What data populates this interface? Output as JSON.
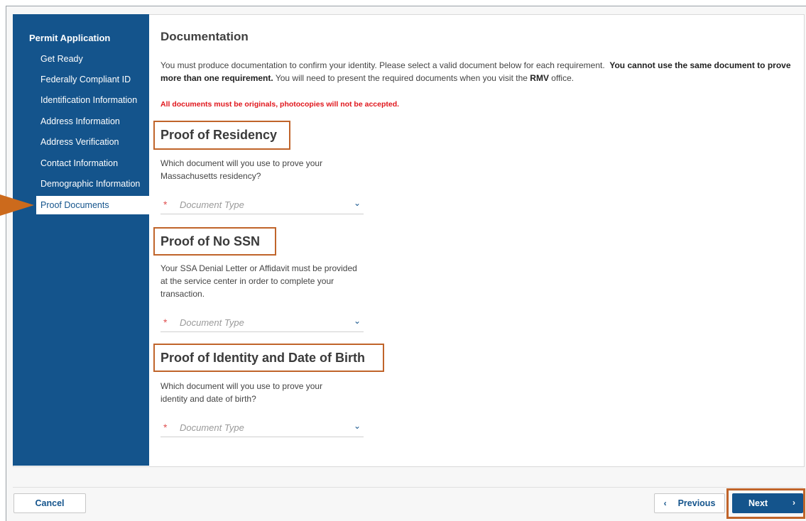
{
  "sidebar": {
    "title": "Permit Application",
    "items": [
      {
        "label": "Get Ready"
      },
      {
        "label": "Federally Compliant ID"
      },
      {
        "label": "Identification Information"
      },
      {
        "label": "Address Information"
      },
      {
        "label": "Address Verification"
      },
      {
        "label": "Contact Information"
      },
      {
        "label": "Demographic Information"
      },
      {
        "label": "Proof Documents",
        "active": true
      }
    ]
  },
  "main": {
    "title": "Documentation",
    "intro_normal_1": "You must produce documentation to confirm your identity. Please select a valid document below for each requirement.",
    "intro_bold": "You cannot use the same document to prove more than one requirement.",
    "intro_normal_2": "You will need to present the required documents when you visit the",
    "intro_rmv": "RMV",
    "intro_end": "office.",
    "warning": "All documents must be originals, photocopies will not be accepted.",
    "sections": [
      {
        "heading": "Proof of Residency",
        "description": "Which document will you use to prove your Massachusetts residency?",
        "select_required_mark": "*",
        "select_placeholder": "Document Type"
      },
      {
        "heading": "Proof of No SSN",
        "description": "Your SSA Denial Letter or Affidavit must be provided at the service center in order to complete your transaction.",
        "select_required_mark": "*",
        "select_placeholder": "Document Type"
      },
      {
        "heading": "Proof of Identity and Date of Birth",
        "description": "Which document will you use to prove your identity and date of birth?",
        "select_required_mark": "*",
        "select_placeholder": "Document Type"
      }
    ]
  },
  "footer": {
    "cancel_label": "Cancel",
    "previous_label": "Previous",
    "next_label": "Next"
  },
  "colors": {
    "sidebar_bg": "#14548c",
    "highlight_outline": "#c0642a",
    "warning_red": "#e0161c",
    "callout_arrow": "#cc6a1c"
  },
  "icons": {
    "dropdown": "chevron-down-icon",
    "previous": "chevron-left-icon",
    "next": "chevron-right-icon"
  }
}
